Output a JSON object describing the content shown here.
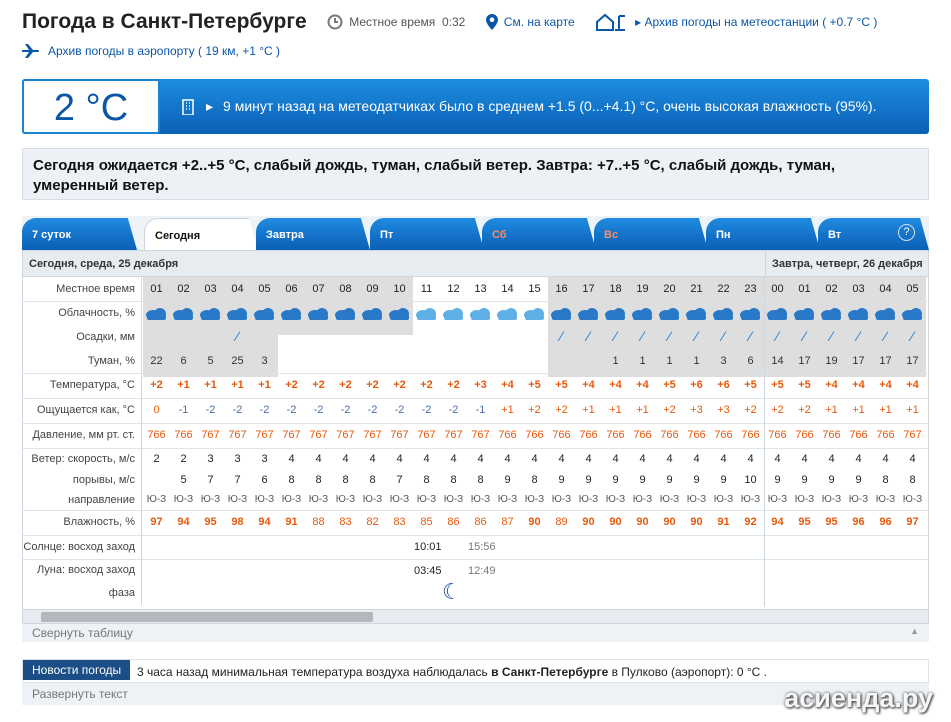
{
  "header": {
    "title": "Погода в Санкт-Петербурге",
    "local_time_label": "Местное время",
    "local_time": "0:32",
    "map_link": "См. на карте",
    "archive_station": "Архив погоды на метеостанции ( +0.7 °C )",
    "archive_airport": "Архив погоды в аэропорту ( 19 км, +1 °C )"
  },
  "current": {
    "temp": "2 °C",
    "note": "9 минут назад на метеодатчиках было в среднем +1.5 (0...+4.1) °C, очень высокая влажность (95%)."
  },
  "forecast_text": "Сегодня ожидается +2..+5 °C, слабый дождь, туман, слабый ветер. Завтра: +7..+5 °C, слабый дождь, туман, умеренный ветер.",
  "tabs": [
    "7 суток",
    "Сегодня",
    "Завтра",
    "Пт",
    "Сб",
    "Вс",
    "Пн",
    "Вт"
  ],
  "help": "?",
  "days": {
    "today": "Сегодня, среда, 25 декабря",
    "tomorrow": "Завтра, четверг, 26 декабря"
  },
  "row_labels": {
    "time": "Местное время",
    "clouds": "Облачность, %",
    "precip": "Осадки, мм",
    "fog": "Туман, %",
    "temp": "Температура, °C",
    "feels": "Ощущается как, °C",
    "pressure": "Давление, мм рт. ст.",
    "wind": "Ветер: скорость, м/с",
    "gusts": "порывы, м/с",
    "direction": "направление",
    "humidity": "Влажность, %",
    "sun": "Солнце: восход заход",
    "moon": "Луна: восход заход",
    "phase": "фаза"
  },
  "hours": [
    "01",
    "02",
    "03",
    "04",
    "05",
    "06",
    "07",
    "08",
    "09",
    "10",
    "11",
    "12",
    "13",
    "14",
    "15",
    "16",
    "17",
    "18",
    "19",
    "20",
    "21",
    "22",
    "23",
    "00",
    "01",
    "02",
    "03",
    "04",
    "05"
  ],
  "fog": [
    "22",
    "6",
    "5",
    "25",
    "3",
    "",
    "",
    "",
    "",
    "",
    "",
    "",
    "",
    "",
    "",
    "",
    "",
    "1",
    "1",
    "1",
    "1",
    "3",
    "6",
    "14",
    "17",
    "19",
    "17",
    "17",
    "17"
  ],
  "temp": [
    "+2",
    "+1",
    "+1",
    "+1",
    "+1",
    "+2",
    "+2",
    "+2",
    "+2",
    "+2",
    "+2",
    "+2",
    "+3",
    "+4",
    "+5",
    "+5",
    "+4",
    "+4",
    "+4",
    "+5",
    "+6",
    "+6",
    "+5",
    "+5",
    "+5",
    "+4",
    "+4",
    "+4",
    "+4"
  ],
  "feels": [
    "0",
    "-1",
    "-2",
    "-2",
    "-2",
    "-2",
    "-2",
    "-2",
    "-2",
    "-2",
    "-2",
    "-2",
    "-1",
    "+1",
    "+2",
    "+2",
    "+1",
    "+1",
    "+1",
    "+2",
    "+3",
    "+3",
    "+2",
    "+2",
    "+2",
    "+1",
    "+1",
    "+1",
    "+1"
  ],
  "pressure": [
    "766",
    "766",
    "767",
    "767",
    "767",
    "767",
    "767",
    "767",
    "767",
    "767",
    "767",
    "767",
    "767",
    "766",
    "766",
    "766",
    "766",
    "766",
    "766",
    "766",
    "766",
    "766",
    "766",
    "766",
    "766",
    "766",
    "766",
    "766",
    "767"
  ],
  "wind": [
    "2",
    "2",
    "3",
    "3",
    "3",
    "4",
    "4",
    "4",
    "4",
    "4",
    "4",
    "4",
    "4",
    "4",
    "4",
    "4",
    "4",
    "4",
    "4",
    "4",
    "4",
    "4",
    "4",
    "4",
    "4",
    "4",
    "4",
    "4",
    "4"
  ],
  "gusts": [
    "",
    "5",
    "7",
    "7",
    "6",
    "8",
    "8",
    "8",
    "8",
    "7",
    "8",
    "8",
    "8",
    "9",
    "8",
    "9",
    "9",
    "9",
    "9",
    "9",
    "9",
    "9",
    "10",
    "9",
    "9",
    "9",
    "9",
    "8",
    "8"
  ],
  "direction": "Ю-З",
  "humidity": [
    "97",
    "94",
    "95",
    "98",
    "94",
    "91",
    "88",
    "83",
    "82",
    "83",
    "85",
    "86",
    "86",
    "87",
    "90",
    "89",
    "90",
    "90",
    "90",
    "90",
    "90",
    "91",
    "92",
    "94",
    "95",
    "95",
    "96",
    "96",
    "97"
  ],
  "sun": {
    "rise": "10:01",
    "set": "15:56"
  },
  "moon": {
    "rise": "03:45",
    "set": "12:49"
  },
  "collapse": "Свернуть таблицу",
  "news": {
    "button": "Новости погоды",
    "text_before": "3 часа назад минимальная температура воздуха наблюдалась ",
    "city": "в Санкт-Петербурге",
    "text_after": " в Пулково (аэропорт): 0 °С ."
  },
  "expand": "Развернуть текст",
  "watermark": "асиенда.ру"
}
